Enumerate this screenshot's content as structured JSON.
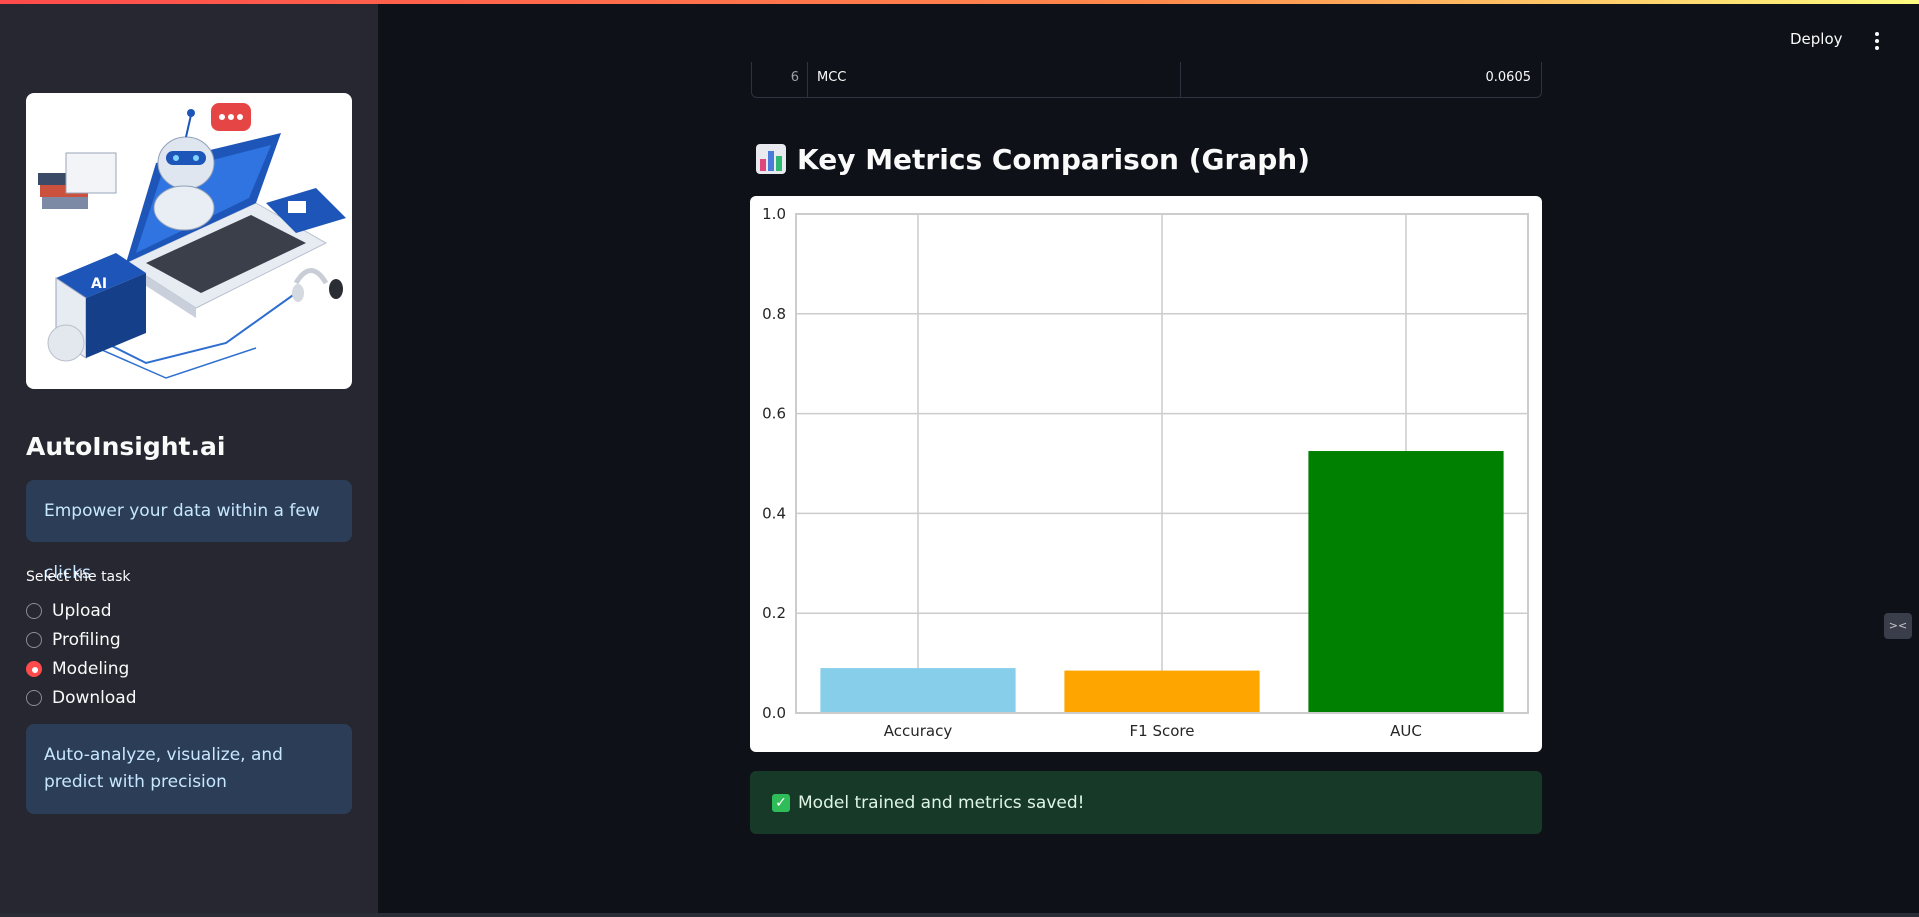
{
  "header": {
    "deploy_label": "Deploy",
    "menu_icon": "kebab-menu-icon"
  },
  "sidebar": {
    "app_title": "AutoInsight.ai",
    "tagline": "Empower your data within a few clicks",
    "task_label": "Select the task",
    "tasks": [
      {
        "label": "Upload",
        "selected": false
      },
      {
        "label": "Profiling",
        "selected": false
      },
      {
        "label": "Modeling",
        "selected": true
      },
      {
        "label": "Download",
        "selected": false
      }
    ],
    "description": "Auto-analyze, visualize, and predict with precision",
    "accent_color": "#ff4b4b"
  },
  "metrics_table": {
    "row_index": "6",
    "metric": "MCC",
    "value": "0.0605"
  },
  "section": {
    "title": "Key Metrics Comparison (Graph)",
    "icon": "bar-chart-icon"
  },
  "chart_data": {
    "type": "bar",
    "categories": [
      "Accuracy",
      "F1 Score",
      "AUC"
    ],
    "values": [
      0.09,
      0.085,
      0.525
    ],
    "colors": [
      "#87ceeb",
      "#ffa500",
      "#008000"
    ],
    "ylim": [
      0,
      1.0
    ],
    "yticks": [
      "0.0",
      "0.2",
      "0.4",
      "0.6",
      "0.8",
      "1.0"
    ],
    "grid": true
  },
  "status": {
    "message": "Model trained and metrics saved!",
    "color": "#2ebd59"
  }
}
